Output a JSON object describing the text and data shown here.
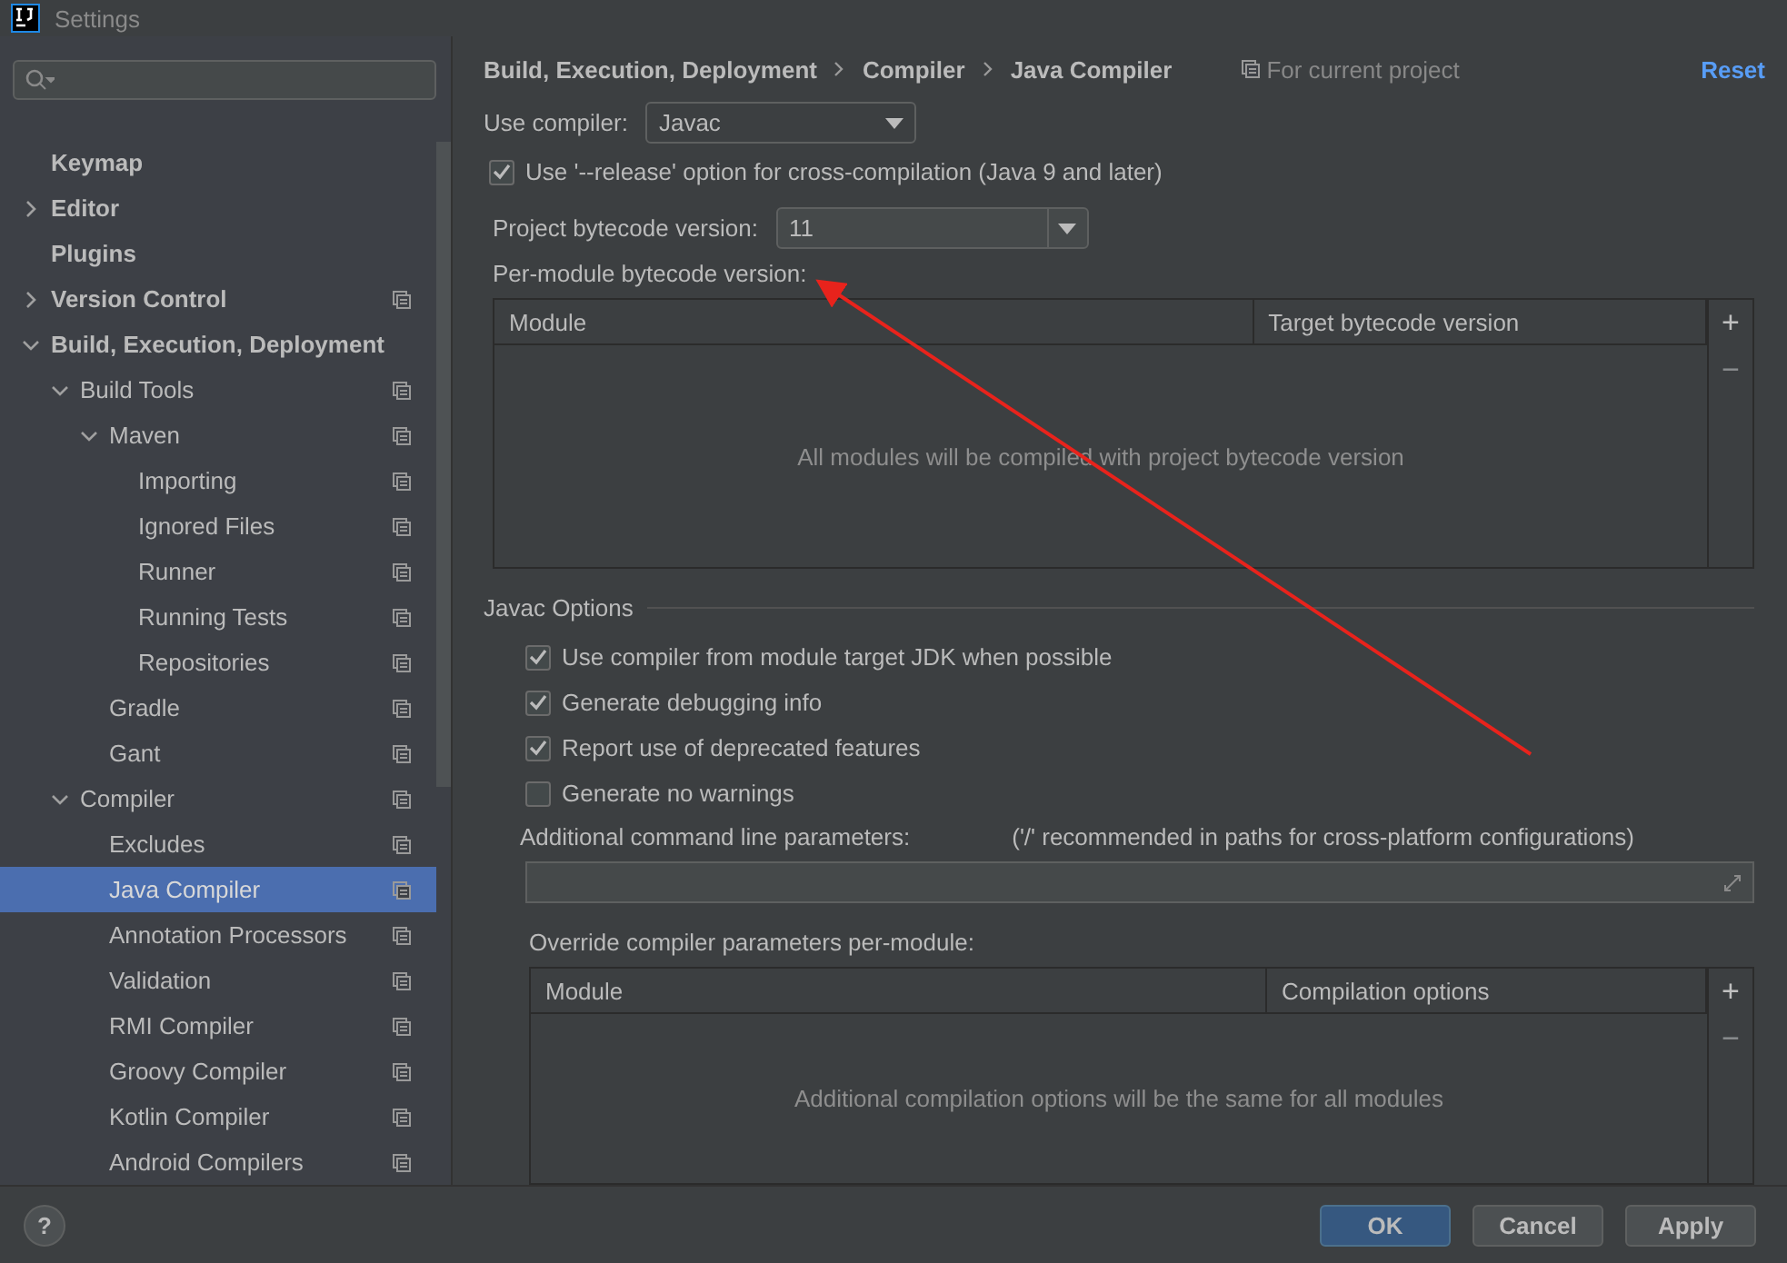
{
  "window": {
    "title": "Settings"
  },
  "sidebar": {
    "tree": [
      {
        "label": "Keymap",
        "scoped": false,
        "selected": false
      },
      {
        "label": "Editor",
        "expanded": false,
        "scoped": false,
        "selected": false
      },
      {
        "label": "Plugins",
        "scoped": false,
        "selected": false
      },
      {
        "label": "Version Control",
        "expanded": false,
        "scoped": true,
        "selected": false
      },
      {
        "label": "Build, Execution, Deployment",
        "expanded": true,
        "scoped": false,
        "selected": false,
        "children": [
          {
            "label": "Build Tools",
            "expanded": true,
            "scoped": true,
            "selected": false,
            "children": [
              {
                "label": "Maven",
                "expanded": true,
                "scoped": true,
                "selected": false,
                "children": [
                  {
                    "label": "Importing",
                    "scoped": true,
                    "selected": false
                  },
                  {
                    "label": "Ignored Files",
                    "scoped": true,
                    "selected": false
                  },
                  {
                    "label": "Runner",
                    "scoped": true,
                    "selected": false
                  },
                  {
                    "label": "Running Tests",
                    "scoped": true,
                    "selected": false
                  },
                  {
                    "label": "Repositories",
                    "scoped": true,
                    "selected": false
                  }
                ]
              },
              {
                "label": "Gradle",
                "scoped": true,
                "selected": false
              },
              {
                "label": "Gant",
                "scoped": true,
                "selected": false
              }
            ]
          },
          {
            "label": "Compiler",
            "expanded": true,
            "scoped": true,
            "selected": false,
            "children": [
              {
                "label": "Excludes",
                "scoped": true,
                "selected": false
              },
              {
                "label": "Java Compiler",
                "scoped": true,
                "selected": true
              },
              {
                "label": "Annotation Processors",
                "scoped": true,
                "selected": false
              },
              {
                "label": "Validation",
                "scoped": true,
                "selected": false
              },
              {
                "label": "RMI Compiler",
                "scoped": true,
                "selected": false
              },
              {
                "label": "Groovy Compiler",
                "scoped": true,
                "selected": false
              },
              {
                "label": "Kotlin Compiler",
                "scoped": true,
                "selected": false
              },
              {
                "label": "Android Compilers",
                "scoped": true,
                "selected": false
              }
            ]
          }
        ]
      }
    ]
  },
  "breadcrumb": [
    "Build, Execution, Deployment",
    "Compiler",
    "Java Compiler"
  ],
  "scope_note": "For current project",
  "reset": "Reset",
  "use_compiler": {
    "label": "Use compiler:",
    "value": "Javac"
  },
  "release_option": {
    "label": "Use '--release' option for cross-compilation (Java 9 and later)",
    "checked": true
  },
  "project_bytecode": {
    "label": "Project bytecode version:",
    "value": "11"
  },
  "per_module": {
    "label": "Per-module bytecode version:",
    "columns": [
      "Module",
      "Target bytecode version"
    ],
    "empty_text": "All modules will be compiled with project bytecode version",
    "tools": [
      "+",
      "−"
    ]
  },
  "javac_options": {
    "title": "Javac Options",
    "checkboxes": [
      {
        "label": "Use compiler from module target JDK when possible",
        "checked": true
      },
      {
        "label": "Generate debugging info",
        "checked": true
      },
      {
        "label": "Report use of deprecated features",
        "checked": true
      },
      {
        "label": "Generate no warnings",
        "checked": false
      }
    ],
    "additional": {
      "label": "Additional command line parameters:",
      "hint": "('/' recommended in paths for cross-platform configurations)"
    },
    "override": {
      "label": "Override compiler parameters per-module:",
      "columns": [
        "Module",
        "Compilation options"
      ],
      "empty_text": "Additional compilation options will be the same for all modules",
      "tools": [
        "+",
        "−"
      ]
    }
  },
  "buttons": [
    {
      "label": "OK",
      "primary": true
    },
    {
      "label": "Cancel",
      "primary": false
    },
    {
      "label": "Apply",
      "primary": false
    }
  ],
  "help": "?"
}
